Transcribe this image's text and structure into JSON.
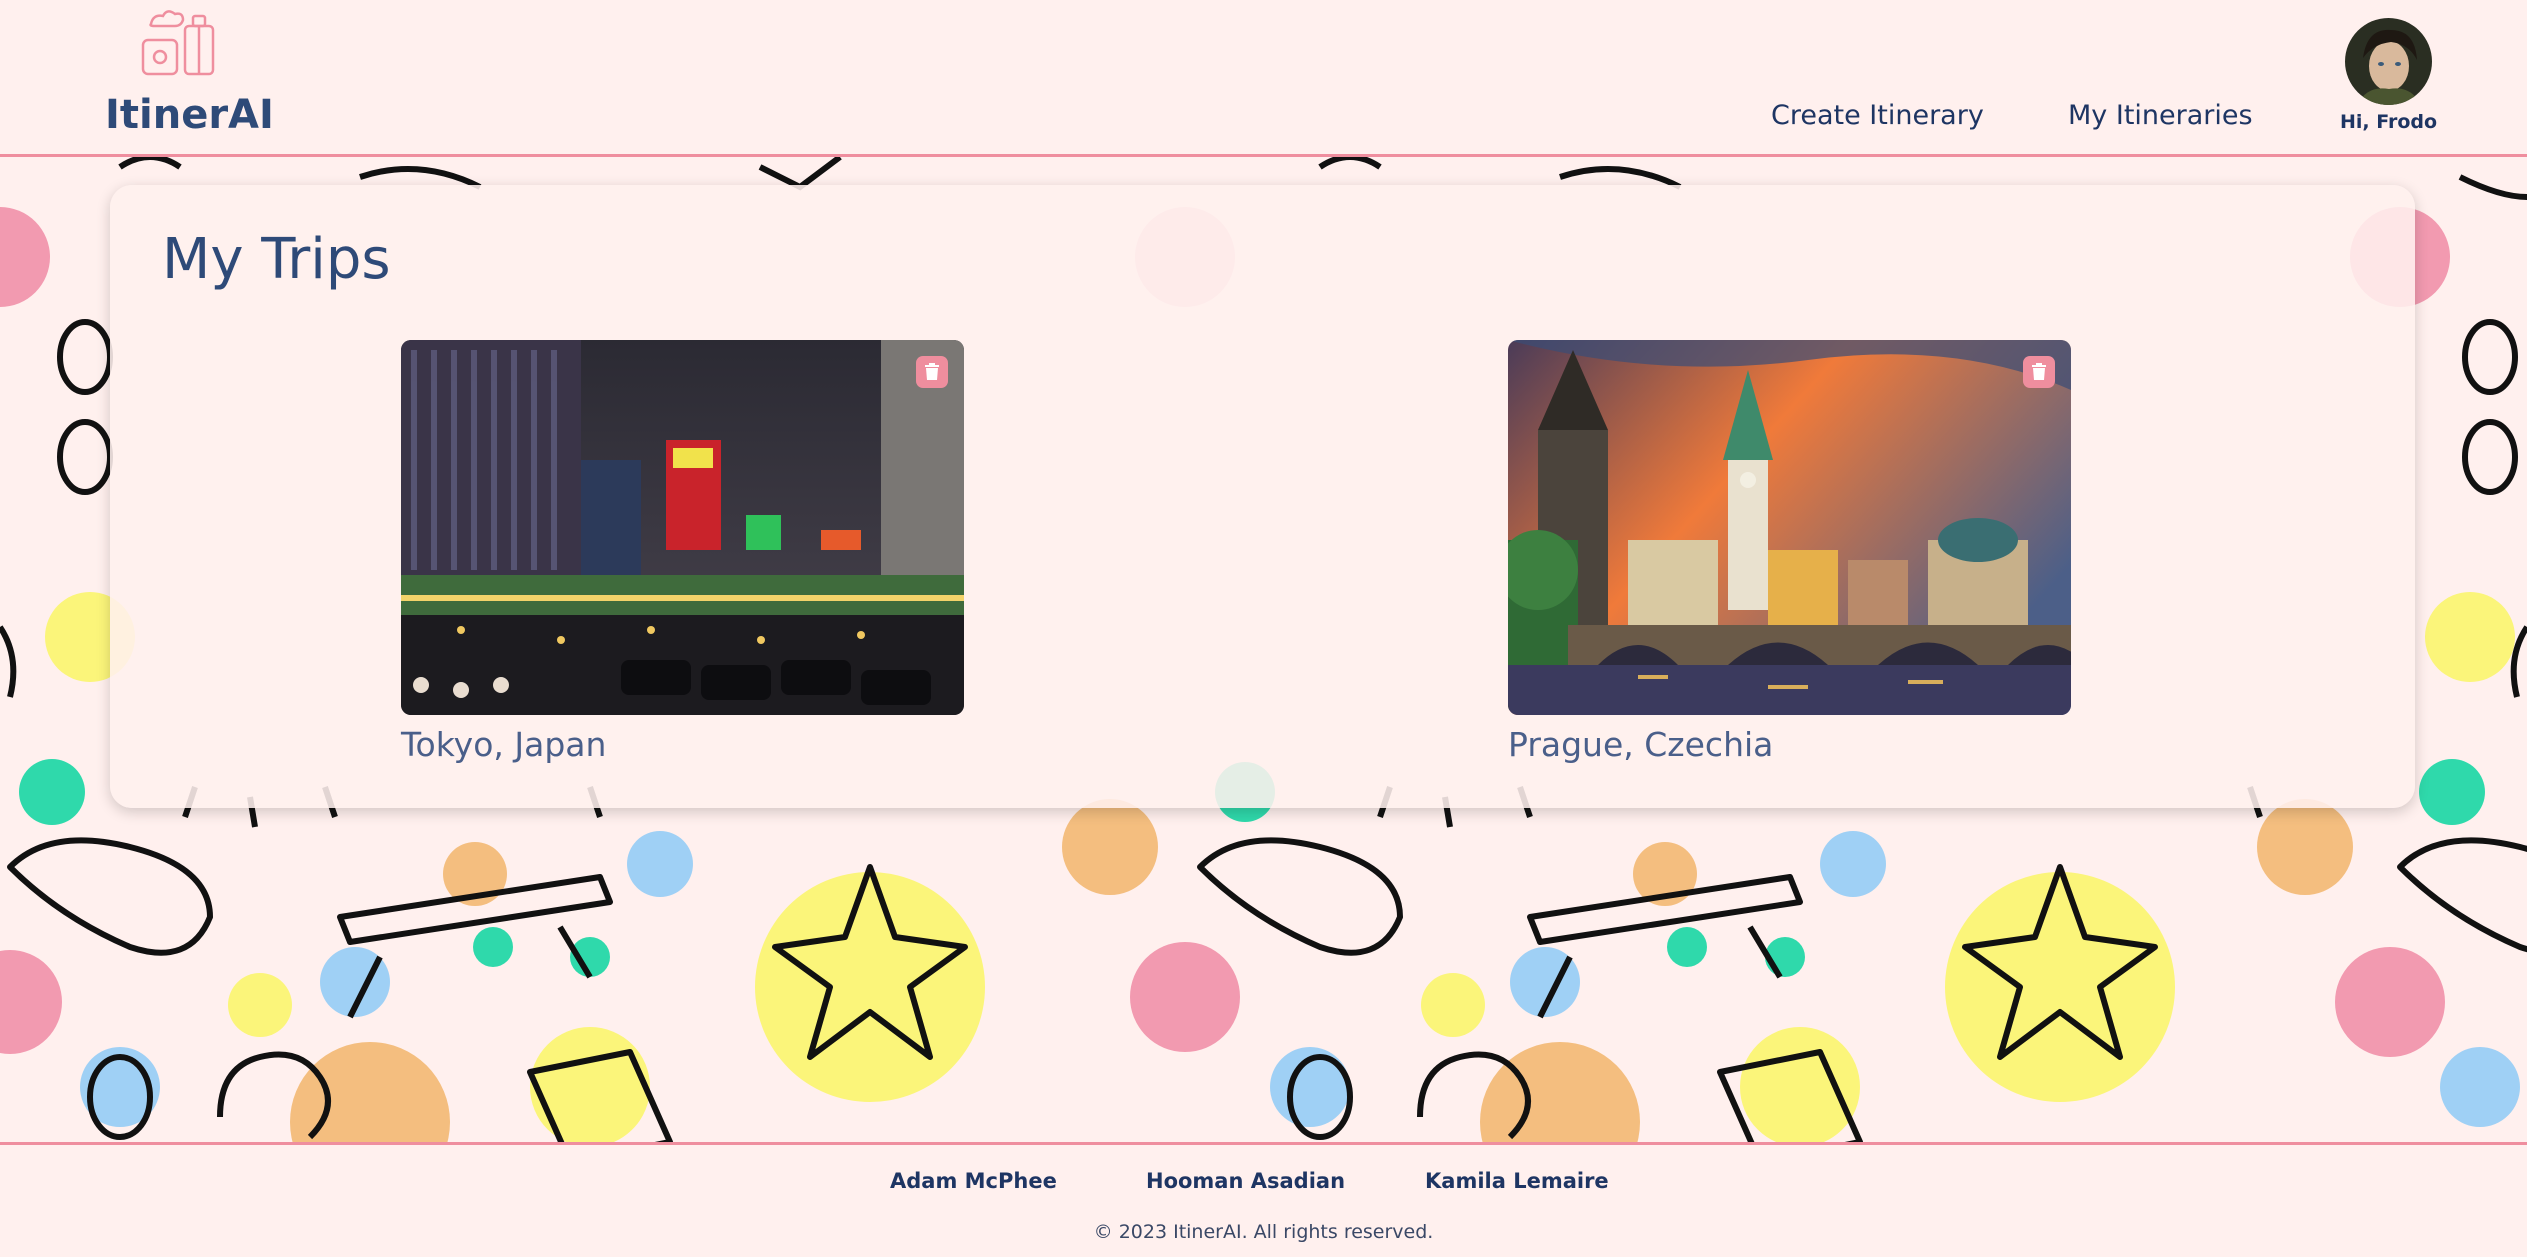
{
  "app": {
    "name": "ItinerAI"
  },
  "nav": {
    "create_itinerary": "Create Itinerary",
    "my_itineraries": "My Itineraries",
    "greeting": "Hi, Frodo"
  },
  "main": {
    "title": "My Trips",
    "trips": [
      {
        "label": "Tokyo, Japan",
        "image": "night-city-street-photo"
      },
      {
        "label": "Prague, Czechia",
        "image": "old-town-bridge-photo"
      }
    ]
  },
  "footer": {
    "authors": [
      "Adam McPhee",
      "Hooman Asadian",
      "Kamila Lemaire"
    ],
    "copyright": "© 2023 ItinerAI. All rights reserved."
  },
  "colors": {
    "accent": "#ef8e9e",
    "navy": "#1e3563",
    "background": "#fff0ee"
  }
}
